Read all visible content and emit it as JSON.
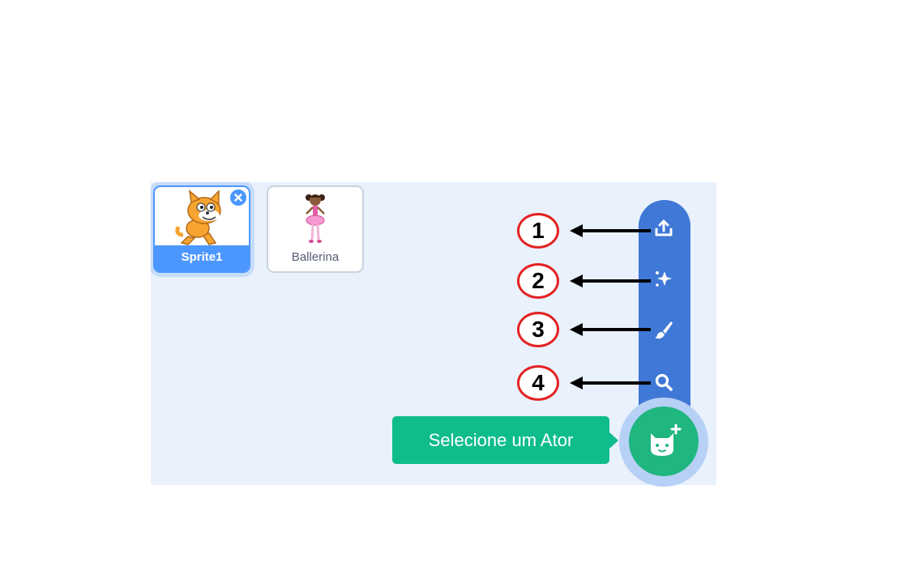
{
  "sprites": [
    {
      "name": "Sprite1",
      "selected": true,
      "thumbnail_icon": "scratch-cat-icon"
    },
    {
      "name": "Ballerina",
      "selected": false,
      "thumbnail_icon": "ballerina-icon"
    }
  ],
  "sprite_menu": {
    "items": [
      {
        "callout": "1",
        "icon": "upload-icon"
      },
      {
        "callout": "2",
        "icon": "surprise-sparkle-icon"
      },
      {
        "callout": "3",
        "icon": "paint-brush-icon"
      },
      {
        "callout": "4",
        "icon": "search-icon"
      }
    ],
    "main_button_icon": "cat-plus-icon",
    "tooltip": "Selecione um Ator"
  },
  "colors": {
    "pane_bg": "#e9f1fc",
    "accent_blue": "#4c97ff",
    "menu_blue": "#3f78d6",
    "green": "#0fbd8c",
    "callout_red": "#e32222"
  }
}
